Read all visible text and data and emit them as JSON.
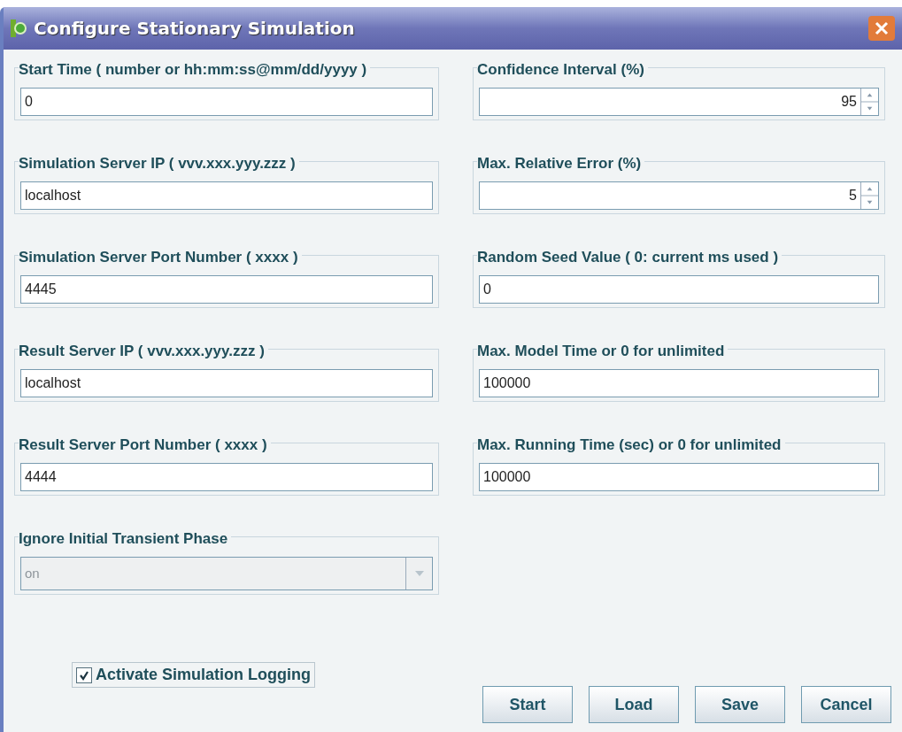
{
  "window": {
    "title": "Configure Stationary Simulation"
  },
  "left_fields": [
    {
      "kind": "text",
      "label": "Start Time ( number or hh:mm:ss@mm/dd/yyyy )",
      "value": "0"
    },
    {
      "kind": "text",
      "label": "Simulation Server IP  ( vvv.xxx.yyy.zzz )",
      "value": "localhost"
    },
    {
      "kind": "text",
      "label": "Simulation Server Port Number ( xxxx )",
      "value": "4445"
    },
    {
      "kind": "text",
      "label": "Result Server IP  ( vvv.xxx.yyy.zzz )",
      "value": "localhost"
    },
    {
      "kind": "text",
      "label": "Result Server Port Number ( xxxx )",
      "value": "4444"
    },
    {
      "kind": "select",
      "label": "Ignore Initial Transient Phase",
      "value": "on",
      "disabled": true
    }
  ],
  "right_fields": [
    {
      "kind": "spinner",
      "label": "Confidence Interval (%)",
      "value": "95"
    },
    {
      "kind": "spinner",
      "label": "Max. Relative Error (%)",
      "value": "5"
    },
    {
      "kind": "text",
      "label": "Random Seed Value ( 0: current ms used )",
      "value": "0"
    },
    {
      "kind": "text",
      "label": "Max. Model Time or 0 for unlimited",
      "value": "100000"
    },
    {
      "kind": "text",
      "label": "Max. Running Time (sec) or 0 for unlimited",
      "value": "100000"
    }
  ],
  "logging": {
    "label": "Activate Simulation Logging",
    "checked": true
  },
  "buttons": [
    "Start",
    "Load",
    "Save",
    "Cancel"
  ]
}
